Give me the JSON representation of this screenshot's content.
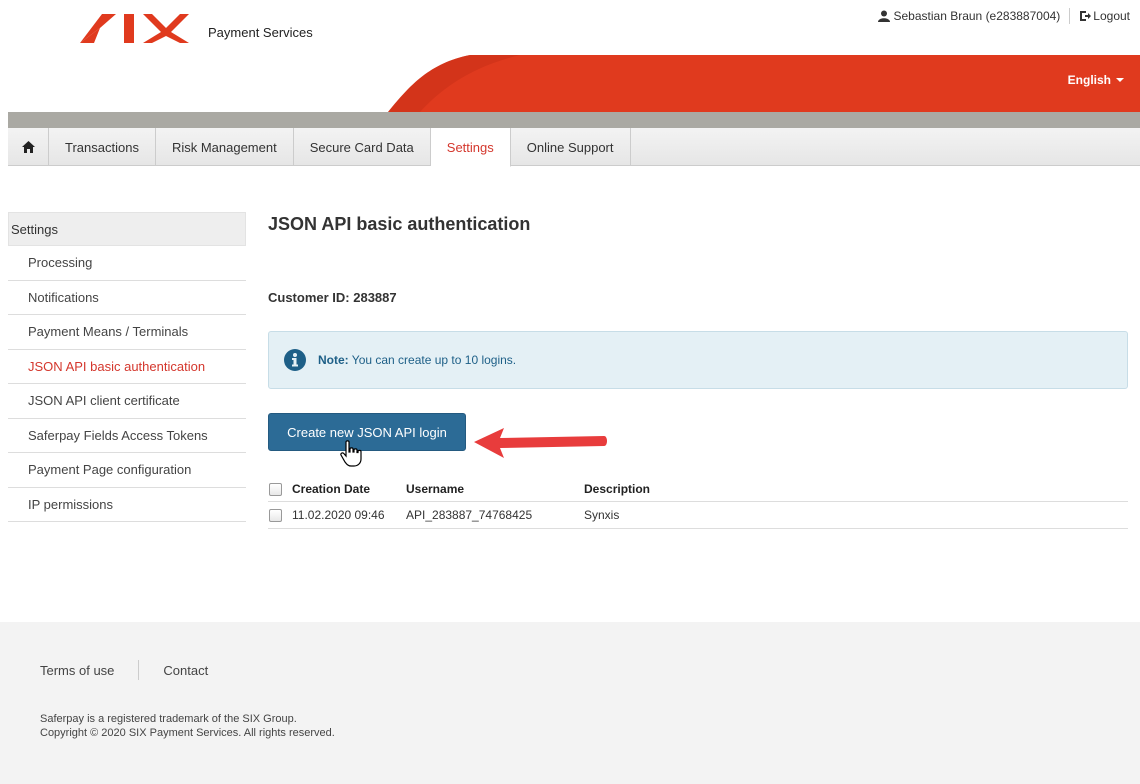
{
  "header": {
    "brand_sub": "Payment Services",
    "user": "Sebastian Braun (e283887004)",
    "logout": "Logout",
    "language": "English",
    "red": "#e03a1e",
    "dark_red": "#c22a17"
  },
  "nav": {
    "tabs": [
      {
        "label": "Transactions"
      },
      {
        "label": "Risk Management"
      },
      {
        "label": "Secure Card Data"
      },
      {
        "label": "Settings"
      },
      {
        "label": "Online Support"
      }
    ],
    "active_color": "#d4372d"
  },
  "sidebar": {
    "header": "Settings",
    "items": [
      {
        "label": "Processing"
      },
      {
        "label": "Notifications"
      },
      {
        "label": "Payment Means / Terminals"
      },
      {
        "label": "JSON API basic authentication"
      },
      {
        "label": "JSON API client certificate"
      },
      {
        "label": "Saferpay Fields Access Tokens"
      },
      {
        "label": "Payment Page configuration"
      },
      {
        "label": "IP permissions"
      }
    ]
  },
  "main": {
    "title": "JSON API basic authentication",
    "customer": "Customer ID: 283887",
    "note_bold": "Note:",
    "note_text": " You can create up to 10 logins.",
    "create_button": "Create new JSON API login",
    "table": {
      "headers": [
        "Creation Date",
        "Username",
        "Description"
      ],
      "rows": [
        [
          "11.02.2020 09:46",
          "API_283887_74768425",
          "Synxis"
        ]
      ]
    }
  },
  "footer": {
    "terms": "Terms of use",
    "contact": "Contact",
    "line1": "Saferpay is a registered trademark of the SIX Group.",
    "line2": "Copyright © 2020 SIX Payment Services. All rights reserved."
  }
}
